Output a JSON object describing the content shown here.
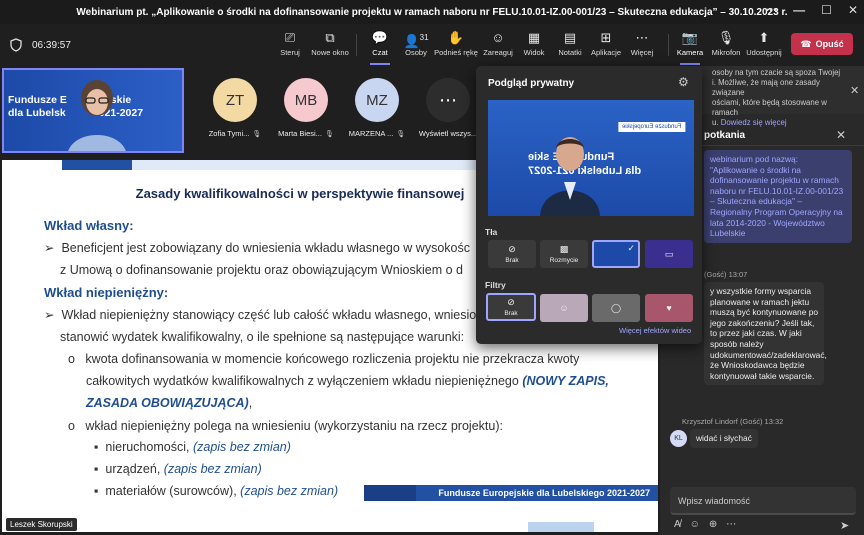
{
  "window": {
    "title": "Webinarium pt. „Aplikowanie o środki na dofinansowanie projektu w ramach naboru nr FELU.10.01-IZ.00-001/23 – Skuteczna edukacja” – 30.10.2023 r."
  },
  "toolbar": {
    "timer": "06:39:57",
    "buttons": [
      {
        "label": "Steruj",
        "icon": "share-control-icon"
      },
      {
        "label": "Nowe okno",
        "icon": "new-window-icon"
      },
      {
        "label": "Czat",
        "icon": "chat-icon"
      },
      {
        "label": "Osoby",
        "icon": "people-icon",
        "badge": "31"
      },
      {
        "label": "Podnieś rękę",
        "icon": "raise-hand-icon"
      },
      {
        "label": "Zareaguj",
        "icon": "react-icon"
      },
      {
        "label": "Widok",
        "icon": "view-icon"
      },
      {
        "label": "Notatki",
        "icon": "notes-icon"
      },
      {
        "label": "Aplikacje",
        "icon": "apps-icon"
      },
      {
        "label": "Więcej",
        "icon": "more-icon"
      },
      {
        "label": "Kamera",
        "icon": "camera-icon"
      },
      {
        "label": "Mikrofon",
        "icon": "mic-off-icon"
      },
      {
        "label": "Udostępnij",
        "icon": "share-icon"
      }
    ],
    "leave_label": "Opuść",
    "leave_color": "#c4314b"
  },
  "participants": {
    "self_banner": "Fundusze Europejskie dla Lubelskie 2021-2027",
    "self_banner_line1": "Fundusze E",
    "self_banner_word": "lskie",
    "self_banner_line2": "dla Lubelsk",
    "self_banner_years": "021-2027",
    "others": [
      {
        "initials": "ZT",
        "name": "Zofia Tymi...",
        "color": "#f3d9a4"
      },
      {
        "initials": "MB",
        "name": "Marta Biesi...",
        "color": "#f6c9cf"
      },
      {
        "initials": "MZ",
        "name": "MARZENA ...",
        "color": "#c9d6f2"
      }
    ],
    "show_all_label": "Wyświetl wszys..."
  },
  "slide": {
    "title": "Zasady kwalifikowalności w perspektywie finansowej",
    "h1": "Wkład własny:",
    "p1a": "Beneficjent jest zobowiązany do wniesienia wkładu własnego w wysokośc",
    "p1b": "z Umową o dofinansowanie projektu oraz obowiązującym Wnioskiem o d",
    "h2": "Wkład niepieniężny:",
    "p2a": "Wkład niepieniężny stanowiący część lub całość wkładu własnego, wniesio",
    "p2b": "stanowić wydatek kwalifikowalny, o ile spełnione są następujące warunki:",
    "b1a": "kwota dofinansowania w momencie końcowego rozliczenia projektu nie przekracza kwoty",
    "b1b": "całkowitych wydatków kwalifikowalnych z wyłączeniem wkładu niepieniężnego",
    "b1b_note": "(NOWY ZAPIS,",
    "b1c_note": "ZASADA OBOWIĄZUJĄCA)",
    "b1c_tail": ",",
    "b2": "wkład niepieniężny polega na wniesieniu (wykorzystaniu na rzecz projektu):",
    "items": [
      {
        "label": "nieruchomości,",
        "note": "(zapis bez zmian)"
      },
      {
        "label": "urządzeń,",
        "note": "(zapis bez zmian)"
      },
      {
        "label": "materiałów (surowców),",
        "note": "(zapis bez zmian)"
      }
    ],
    "footer": "Fundusze Europejskie dla Lubelskiego 2021-2027",
    "speaker": "Leszek Skorupski"
  },
  "popup": {
    "title": "Podgląd prywatny",
    "preview_tag": "Fundusze Europejskie",
    "preview_text": "Fundusze Europejskie dla Lubelskie 2021-2027",
    "preview_line1": "Fundusze E",
    "preview_word": "skie",
    "preview_line2": "dla Lubelski",
    "preview_years": "021-2027",
    "backgrounds_label": "Tła",
    "backgrounds": [
      {
        "label": "Brak",
        "icon": "none-icon"
      },
      {
        "label": "Rozmycie",
        "icon": "blur-icon"
      },
      {
        "label": "",
        "icon": "custom-bg-icon",
        "selected": true
      },
      {
        "label": "",
        "icon": "image-bg-icon"
      }
    ],
    "filters_label": "Filtry",
    "filters": [
      {
        "label": "Brak",
        "icon": "none-icon",
        "selected": true
      },
      {
        "label": "",
        "icon": "filter-icon"
      },
      {
        "label": "",
        "icon": "filter-icon"
      },
      {
        "label": "",
        "icon": "filter-icon"
      }
    ],
    "more_label": "Więcej efektów wideo"
  },
  "chat": {
    "notice": "osoby na tym czacie są spoza Twojej",
    "notice2": "i. Możliwe, że mają one zasady związane",
    "notice3": "ościami, które będą stosowane w ramach",
    "notice4": "u.",
    "notice_link": "Dowiedz się więcej",
    "title": "potkania",
    "own_message": "webinarium pod nazwą: \"Aplikowanie o środki na dofinansowanie projektu w ramach naboru nr FELU.10.01-IZ.00-001/23 – Skuteczna edukacja\" – Regionalny Program Operacyjny na lata 2014-2020 - Województwo Lubelskie",
    "msg2_meta": "(Gość)  13:07",
    "msg2_text": "y wszystkie formy wsparcia planowane w ramach jektu muszą być kontynuowane po jego zakończeniu? Jeśli tak, to przez jaki czas. W jaki sposób należy udokumentować/zadeklarować, że Wnioskodawca będzie kontynuował takie wsparcie.",
    "msg3_meta": "Krzysztof Lindorf (Gość)  13:32",
    "msg3_initials": "KL",
    "msg3_text": "widać i słychać",
    "compose_placeholder": "Wpisz wiadomość"
  }
}
